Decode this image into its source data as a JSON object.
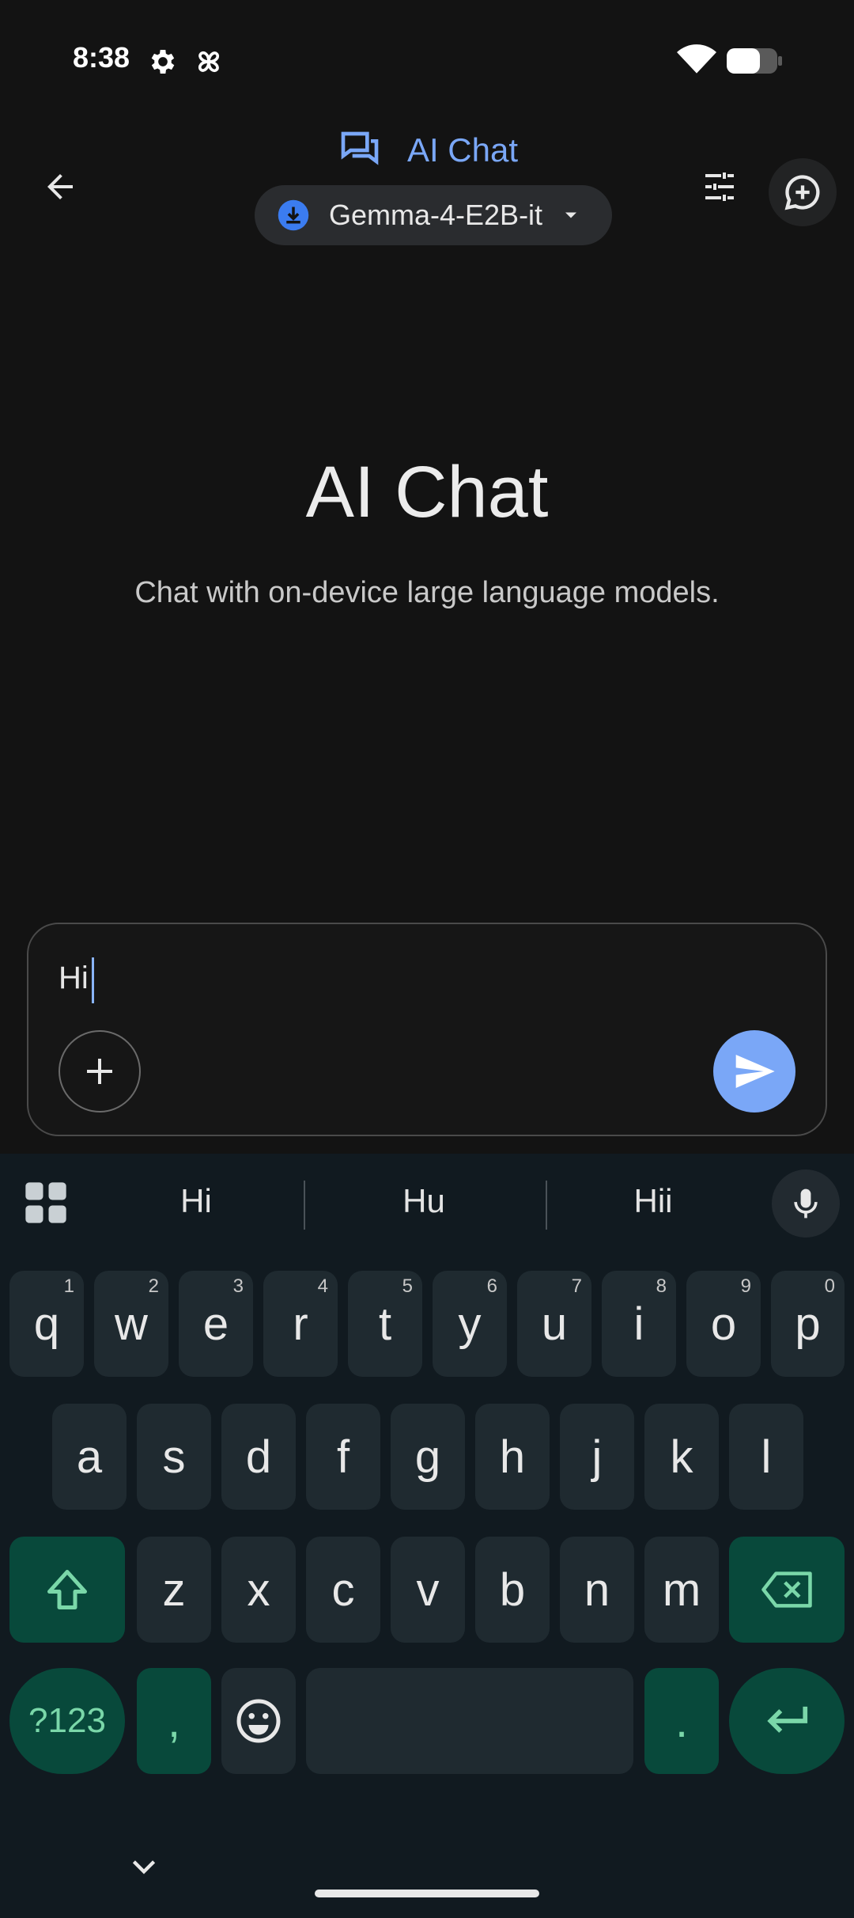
{
  "status_bar": {
    "time": "8:38"
  },
  "header": {
    "title": "AI Chat",
    "model_selector": {
      "selected_model": "Gemma-4-E2B-it"
    }
  },
  "empty_state": {
    "title": "AI Chat",
    "subtitle": "Chat with on-device large language models."
  },
  "composer": {
    "input_value": "Hi"
  },
  "keyboard": {
    "suggestions": [
      "Hi",
      "Hu",
      "Hii"
    ],
    "row1": [
      {
        "k": "q",
        "h": "1"
      },
      {
        "k": "w",
        "h": "2"
      },
      {
        "k": "e",
        "h": "3"
      },
      {
        "k": "r",
        "h": "4"
      },
      {
        "k": "t",
        "h": "5"
      },
      {
        "k": "y",
        "h": "6"
      },
      {
        "k": "u",
        "h": "7"
      },
      {
        "k": "i",
        "h": "8"
      },
      {
        "k": "o",
        "h": "9"
      },
      {
        "k": "p",
        "h": "0"
      }
    ],
    "row2": [
      "a",
      "s",
      "d",
      "f",
      "g",
      "h",
      "j",
      "k",
      "l"
    ],
    "row3": [
      "z",
      "x",
      "c",
      "v",
      "b",
      "n",
      "m"
    ],
    "symbols_label": "?123",
    "comma_label": ",",
    "period_label": "."
  },
  "colors": {
    "accent": "#7aa7f7",
    "keyboard_bg": "#111a20",
    "key_bg": "#1f2a30",
    "function_key_bg": "#08493b",
    "function_key_fg": "#7ad7a9"
  }
}
